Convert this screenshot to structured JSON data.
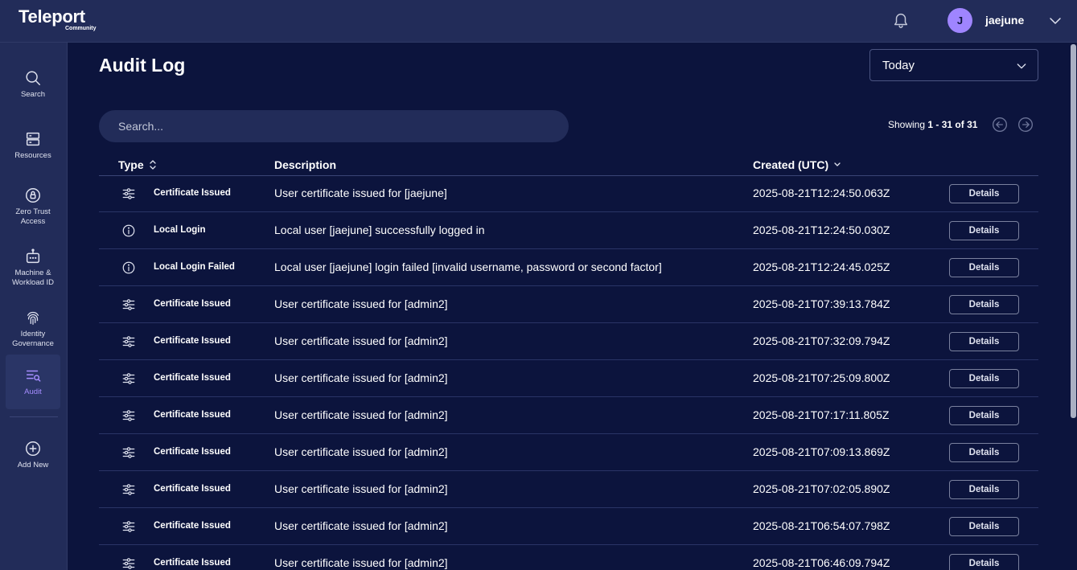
{
  "brand": {
    "name": "Teleport",
    "edition": "Community"
  },
  "user": {
    "initial": "J",
    "name": "jaejune"
  },
  "sidebar": {
    "items": [
      {
        "label": "Search",
        "icon": "search-icon"
      },
      {
        "label": "Resources",
        "icon": "server-icon"
      },
      {
        "label": "Zero Trust Access",
        "icon": "zero-trust-icon"
      },
      {
        "label": "Machine & Workload ID",
        "icon": "robot-icon"
      },
      {
        "label": "Identity Governance",
        "icon": "fingerprint-icon"
      },
      {
        "label": "Audit",
        "icon": "audit-icon",
        "active": true
      },
      {
        "label": "Add New",
        "icon": "plus-circle-icon"
      }
    ]
  },
  "page": {
    "title": "Audit Log"
  },
  "range": {
    "selected": "Today"
  },
  "search": {
    "placeholder": "Search..."
  },
  "pagination": {
    "prefix": "Showing",
    "range": "1 - 31",
    "of": "of",
    "total": "31"
  },
  "table": {
    "headers": {
      "type": "Type",
      "description": "Description",
      "created": "Created (UTC)"
    },
    "details_label": "Details",
    "rows": [
      {
        "icon": "certificate-icon",
        "type": "Certificate Issued",
        "description": "User certificate issued for [jaejune]",
        "created": "2025-08-21T12:24:50.063Z"
      },
      {
        "icon": "info-icon",
        "type": "Local Login",
        "description": "Local user [jaejune] successfully logged in",
        "created": "2025-08-21T12:24:50.030Z"
      },
      {
        "icon": "info-icon",
        "type": "Local Login Failed",
        "description": "Local user [jaejune] login failed [invalid username, password or second factor]",
        "created": "2025-08-21T12:24:45.025Z"
      },
      {
        "icon": "certificate-icon",
        "type": "Certificate Issued",
        "description": "User certificate issued for [admin2]",
        "created": "2025-08-21T07:39:13.784Z"
      },
      {
        "icon": "certificate-icon",
        "type": "Certificate Issued",
        "description": "User certificate issued for [admin2]",
        "created": "2025-08-21T07:32:09.794Z"
      },
      {
        "icon": "certificate-icon",
        "type": "Certificate Issued",
        "description": "User certificate issued for [admin2]",
        "created": "2025-08-21T07:25:09.800Z"
      },
      {
        "icon": "certificate-icon",
        "type": "Certificate Issued",
        "description": "User certificate issued for [admin2]",
        "created": "2025-08-21T07:17:11.805Z"
      },
      {
        "icon": "certificate-icon",
        "type": "Certificate Issued",
        "description": "User certificate issued for [admin2]",
        "created": "2025-08-21T07:09:13.869Z"
      },
      {
        "icon": "certificate-icon",
        "type": "Certificate Issued",
        "description": "User certificate issued for [admin2]",
        "created": "2025-08-21T07:02:05.890Z"
      },
      {
        "icon": "certificate-icon",
        "type": "Certificate Issued",
        "description": "User certificate issued for [admin2]",
        "created": "2025-08-21T06:54:07.798Z"
      },
      {
        "icon": "certificate-icon",
        "type": "Certificate Issued",
        "description": "User certificate issued for [admin2]",
        "created": "2025-08-21T06:46:09.794Z"
      }
    ]
  },
  "colors": {
    "background": "#0c143d",
    "panel": "#222c59",
    "accent": "#9f85ff",
    "active_nav": "#a58dff"
  }
}
